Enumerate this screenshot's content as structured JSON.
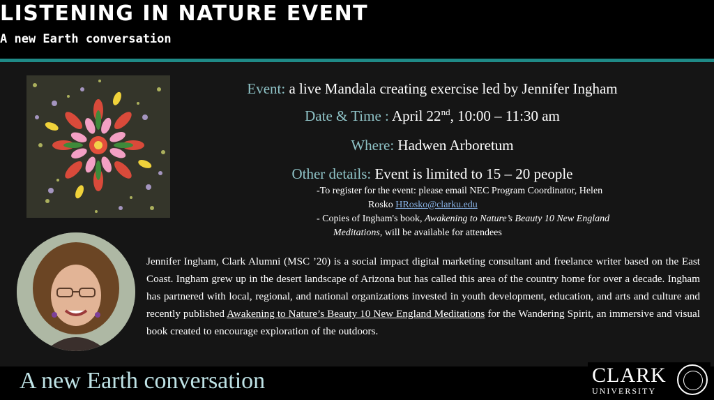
{
  "header": {
    "title": "LISTENING IN NATURE EVENT",
    "subtitle": "A new Earth conversation"
  },
  "event": {
    "event_label": "Event:",
    "event_value": "a live Mandala creating exercise led by Jennifer Ingham",
    "date_label": "Date & Time :",
    "date_value_pre": "April 22",
    "date_value_sup": "nd",
    "date_value_post": ", 10:00 – 11:30 am",
    "where_label": "Where:",
    "where_value": "Hadwen Arboretum",
    "other_label": "Other details:",
    "other_value": "Event is limited to 15 – 20 people",
    "register_text": "-To register for the event: please email NEC Program Coordinator, Helen",
    "register_text_2": "Rosko",
    "register_email": "HRosko@clarku.edu",
    "copies_pre": "- Copies of Ingham's book,",
    "copies_title_1": "Awakening to Nature’s Beauty 10 New England",
    "copies_title_2": "Meditations",
    "copies_post": ", will be available for attendees"
  },
  "bio": {
    "text_1": "Jennifer Ingham, Clark Alumni (MSC ’20) is a social impact digital marketing consultant and freelance writer based on the East Coast. Ingham grew up in the desert landscape of Arizona but has called this area of the country home for over a decade. Ingham has partnered with local, regional, and national organizations invested in youth development, education, and arts and culture and recently published ",
    "book_title": "Awakening to Nature’s Beauty 10 New England Meditations",
    "text_2": " for the Wandering Spirit, an immersive and visual book created to encourage exploration of the outdoors."
  },
  "footer": {
    "tagline": "A new Earth conversation",
    "logo_word": "CLARK",
    "logo_sub": "UNIVERSITY"
  },
  "colors": {
    "accent_teal": "#1f8a87",
    "label_blue": "#8fc3c7",
    "footer_text": "#bfe3e6"
  }
}
